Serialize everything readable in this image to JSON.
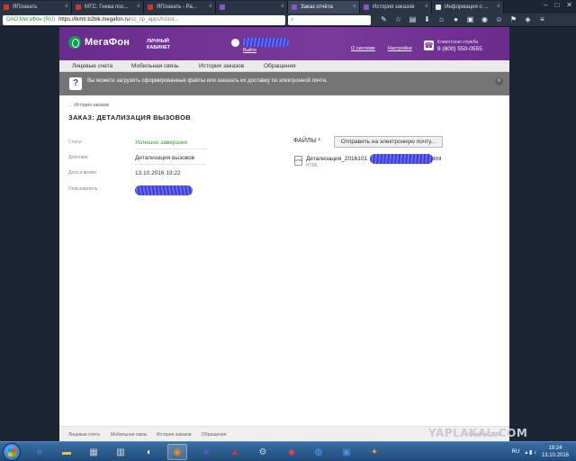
{
  "browser": {
    "tabs": [
      {
        "label": "ЯПлакать",
        "color": "#d8352a"
      },
      {
        "label": "МТС. Гнева пос...",
        "color": "#d8352a"
      },
      {
        "label": "ЯПлакать - Ра...",
        "color": "#d8352a"
      },
      {
        "label": "",
        "color": "#8a55c5"
      },
      {
        "label": "Заказ отчёта",
        "color": "#8a55c5"
      },
      {
        "label": "История заказов",
        "color": "#8a55c5"
      },
      {
        "label": "Информация о ...",
        "color": "#e8e8e8"
      }
    ],
    "active_tab": 4,
    "window_controls": [
      "–",
      "□",
      "✕"
    ],
    "address": {
      "secure_label": "ОАО МегаФон (RU)",
      "host": "https://lkmtr.b2blk.megafon.ru",
      "path": "/sc_cp_apps/histor..."
    },
    "search_placeholder": ""
  },
  "header": {
    "logo_text": "МегаФон",
    "lk_line1": "ЛИЧНЫЙ",
    "lk_line2": "КАБИНЕТ",
    "logout": "Выйти",
    "links": [
      "О системе",
      "Настройки"
    ],
    "support_label": "Клиентская служба",
    "support_phone": "8 (800) 550-0555"
  },
  "nav": {
    "items": [
      "Лицевые счета",
      "Мобильная связь",
      "История заказов",
      "Обращения"
    ]
  },
  "notice": {
    "icon": "?",
    "text": "Вы можете загрузить сформированные файлы или заказать их доставку по электронной почте."
  },
  "order": {
    "back_link": "← История заказов",
    "title": "ЗАКАЗ: ДЕТАЛИЗАЦИЯ ВЫЗОВОВ",
    "fields": [
      {
        "label": "Статус",
        "value": "Успешно завершен"
      },
      {
        "label": "Действие",
        "value": "Детализация вызовов"
      },
      {
        "label": "Дата и время",
        "value": "13.10.2016 19:22"
      },
      {
        "label": "Пользователь",
        "value": ""
      }
    ],
    "files_label": "ФАЙЛЫ ¹",
    "send_button": "Отправить на электронную почту...",
    "file": {
      "icon": "HTML",
      "name_start": "Детализация_2016101",
      "name_end": "html",
      "type": "HTML"
    }
  },
  "footer": {
    "links": [
      "Лицевые счета",
      "Мобильная связь",
      "История заказов",
      "Обращения"
    ],
    "right": "© МегаФон, 2016"
  },
  "watermark": "YAPLAKAL.COM",
  "taskbar": {
    "language": "RU",
    "time": "19:24",
    "date": "13.10.2016"
  }
}
